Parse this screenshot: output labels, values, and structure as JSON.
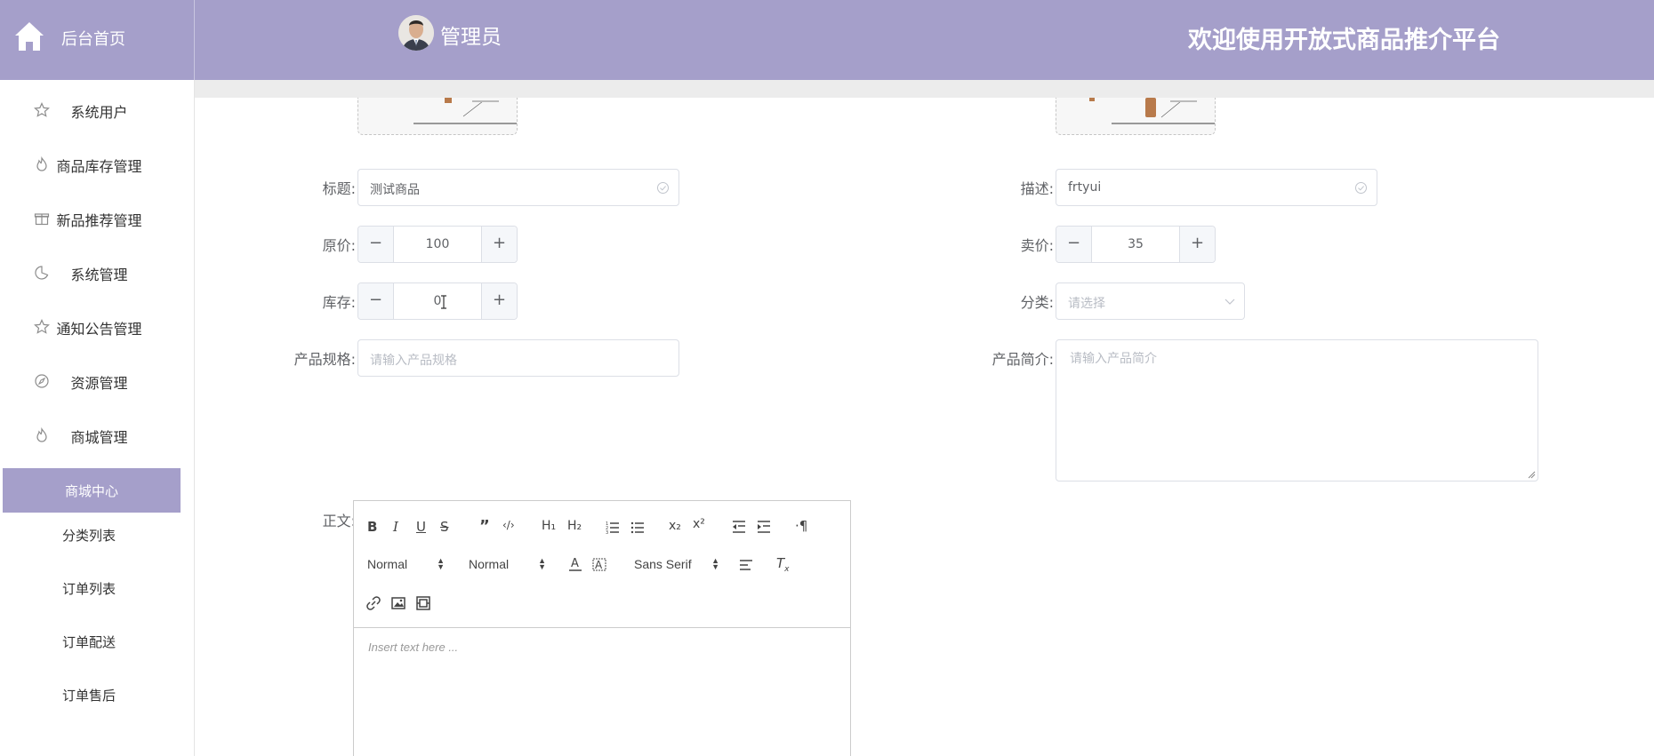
{
  "brand": {
    "home_label": "后台首页"
  },
  "header": {
    "admin_label": "管理员",
    "platform_title": "欢迎使用开放式商品推介平台"
  },
  "sidebar": {
    "items": [
      {
        "label": "系统用户",
        "icon": "star-icon"
      },
      {
        "label": "商品库存管理",
        "icon": "flame-icon"
      },
      {
        "label": "新品推荐管理",
        "icon": "gift-icon"
      },
      {
        "label": "系统管理",
        "icon": "pie-icon"
      },
      {
        "label": "通知公告管理",
        "icon": "star-icon"
      },
      {
        "label": "资源管理",
        "icon": "compass-icon"
      },
      {
        "label": "商城管理",
        "icon": "flame-icon"
      }
    ],
    "sub_items": [
      {
        "label": "商城中心",
        "active": true
      },
      {
        "label": "分类列表"
      },
      {
        "label": "订单列表"
      },
      {
        "label": "订单配送"
      },
      {
        "label": "订单售后"
      }
    ]
  },
  "form": {
    "title": {
      "label": "标题:",
      "value": "测试商品"
    },
    "description": {
      "label": "描述:",
      "value": "frtyui"
    },
    "original_price": {
      "label": "原价:",
      "value": "100"
    },
    "sale_price": {
      "label": "卖价:",
      "value": "35"
    },
    "stock": {
      "label": "库存:",
      "value": "0"
    },
    "category": {
      "label": "分类:",
      "placeholder": "请选择"
    },
    "spec": {
      "label": "产品规格:",
      "placeholder": "请输入产品规格"
    },
    "intro": {
      "label": "产品简介:",
      "placeholder": "请输入产品简介"
    },
    "body": {
      "label": "正文:"
    }
  },
  "editor": {
    "header_select_1": "Normal",
    "header_select_2": "Normal",
    "font_select": "Sans Serif",
    "placeholder": "Insert text here ..."
  },
  "colors": {
    "primary": "#a59fca",
    "border": "#dcdfe6",
    "text": "#606266"
  }
}
